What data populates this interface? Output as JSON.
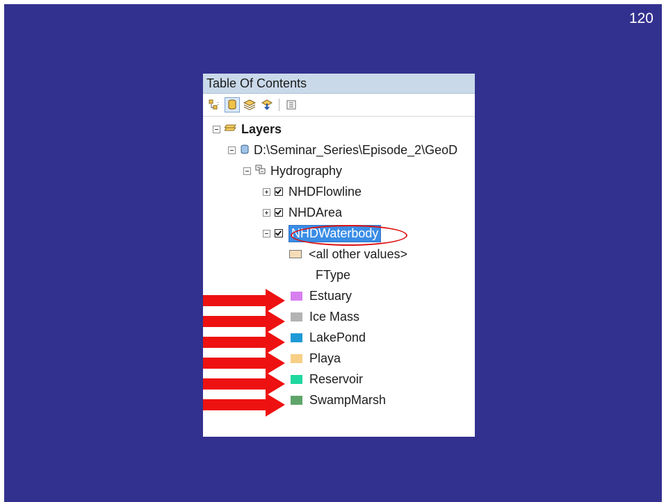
{
  "slide": {
    "page_number": "120",
    "background": "#33318f"
  },
  "toc": {
    "title": "Table Of Contents",
    "toolbar": [
      {
        "icon": "list-by-drawing-order-icon"
      },
      {
        "icon": "list-by-source-icon"
      },
      {
        "icon": "list-by-visibility-icon"
      },
      {
        "icon": "list-by-selection-icon"
      },
      {
        "icon": "options-icon"
      }
    ],
    "layers_label": "Layers",
    "source_label": "D:\\Seminar_Series\\Episode_2\\GeoD",
    "group_label": "Hydrography",
    "layers": [
      {
        "label": "NHDFlowline",
        "checked": true,
        "expanded": false
      },
      {
        "label": "NHDArea",
        "checked": true,
        "expanded": false
      },
      {
        "label": "NHDWaterbody",
        "checked": true,
        "expanded": true,
        "selected": true
      }
    ],
    "all_other_values": {
      "label": "<all other values>",
      "color": "#f5dcb7"
    },
    "field_label": "FType",
    "legend": [
      {
        "label": "Estuary",
        "color": "#d87ff0"
      },
      {
        "label": "Ice Mass",
        "color": "#b3b3b3"
      },
      {
        "label": "LakePond",
        "color": "#1f9ad6"
      },
      {
        "label": "Playa",
        "color": "#f7cf86"
      },
      {
        "label": "Reservoir",
        "color": "#1fd8a0"
      },
      {
        "label": "SwampMarsh",
        "color": "#5fa56b"
      }
    ]
  },
  "annotation": {
    "arrow_color": "#ee1111",
    "oval_color": "#dd1111"
  }
}
